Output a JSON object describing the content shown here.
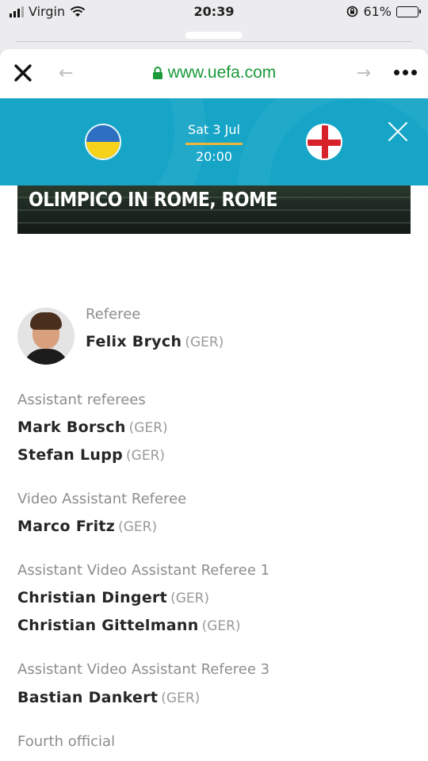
{
  "status_bar": {
    "carrier": "Virgin",
    "time": "20:39",
    "battery_percent": "61%",
    "battery_level": 0.61
  },
  "browser": {
    "url": "www.uefa.com",
    "icons": [
      "close-icon",
      "back-arrow-icon",
      "lock-icon",
      "forward-arrow-icon",
      "more-icon"
    ]
  },
  "match": {
    "date": "Sat 3 Jul",
    "time": "20:00",
    "home_flag": "ukraine-flag-icon",
    "away_flag": "england-flag-icon",
    "colors": {
      "banner": "#16a5c7",
      "accent": "#f0b43a"
    }
  },
  "stadium": {
    "title": "OLIMPICO IN ROME, ROME"
  },
  "officials": {
    "referee": {
      "role": "Referee",
      "name": "Felix Brych",
      "country": "(GER)"
    },
    "assistant_referees": {
      "role": "Assistant referees",
      "people": [
        {
          "name": "Mark Borsch",
          "country": "(GER)"
        },
        {
          "name": "Stefan Lupp",
          "country": "(GER)"
        }
      ]
    },
    "var": {
      "role": "Video Assistant Referee",
      "people": [
        {
          "name": "Marco Fritz",
          "country": "(GER)"
        }
      ]
    },
    "avar1": {
      "role": "Assistant Video Assistant Referee 1",
      "people": [
        {
          "name": "Christian Dingert",
          "country": "(GER)"
        },
        {
          "name": "Christian Gittelmann",
          "country": "(GER)"
        }
      ]
    },
    "avar3": {
      "role": "Assistant Video Assistant Referee 3",
      "people": [
        {
          "name": "Bastian Dankert",
          "country": "(GER)"
        }
      ]
    },
    "fourth": {
      "role": "Fourth official"
    }
  }
}
